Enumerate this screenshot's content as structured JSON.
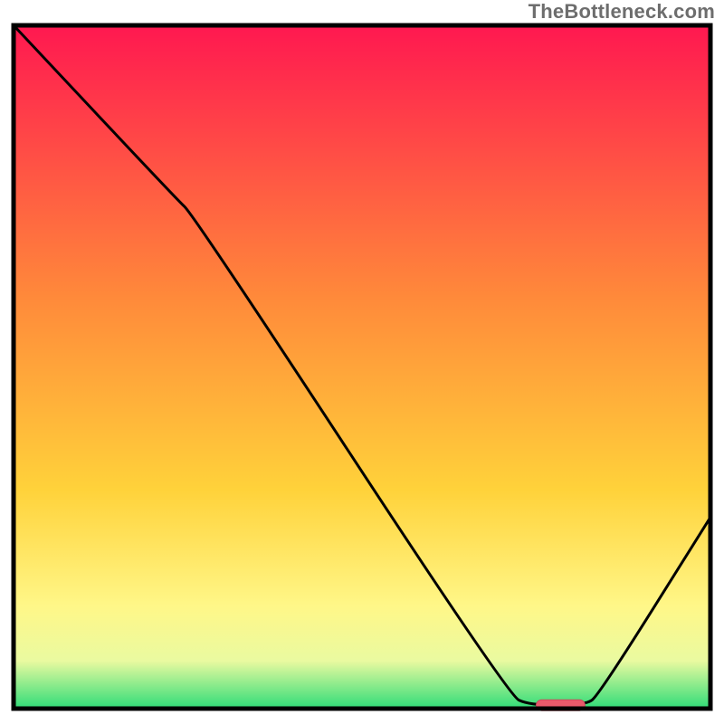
{
  "watermark": "TheBottleneck.com",
  "colors": {
    "border": "#000000",
    "curve": "#000000",
    "marker_fill": "#e85a6b",
    "marker_stroke": "#c94a5b",
    "grad_top": "#ff1850",
    "grad_mid1": "#ff6f3a",
    "grad_mid2": "#ffd23a",
    "grad_mid3": "#fff788",
    "grad_mid4": "#eafaa0",
    "grad_bottom": "#2fdc78"
  },
  "chart_data": {
    "type": "line",
    "title": "",
    "xlabel": "",
    "ylabel": "",
    "xlim": [
      0,
      100
    ],
    "ylim": [
      0,
      100
    ],
    "series": [
      {
        "name": "bottleneck-curve",
        "points": [
          {
            "x": 0.0,
            "y": 100.0
          },
          {
            "x": 23.0,
            "y": 75.0
          },
          {
            "x": 26.0,
            "y": 72.0
          },
          {
            "x": 71.0,
            "y": 2.0
          },
          {
            "x": 74.0,
            "y": 0.5
          },
          {
            "x": 82.0,
            "y": 0.5
          },
          {
            "x": 84.0,
            "y": 2.0
          },
          {
            "x": 100.0,
            "y": 28.0
          }
        ]
      }
    ],
    "marker": {
      "name": "optimal-range",
      "x_start": 75.0,
      "x_end": 82.0,
      "y": 0.5
    }
  }
}
